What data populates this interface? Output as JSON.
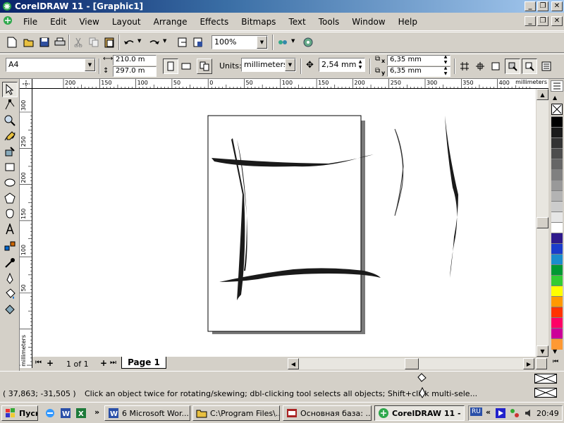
{
  "window": {
    "title": "CorelDRAW 11 - [Graphic1]"
  },
  "menu": [
    "File",
    "Edit",
    "View",
    "Layout",
    "Arrange",
    "Effects",
    "Bitmaps",
    "Text",
    "Tools",
    "Window",
    "Help"
  ],
  "standard_toolbar": {
    "zoom": "100%"
  },
  "property_bar": {
    "paper": "A4",
    "width": "210.0 m",
    "height": "297.0 m",
    "units_label": "Units:",
    "units": "millimeters",
    "nudge": "2,54 mm",
    "dup_x": "6,35 mm",
    "dup_y": "6,35 mm",
    "x_label": "x",
    "y_label": "y"
  },
  "rulers": {
    "units": "millimeters",
    "h_ticks": [
      "200",
      "150",
      "100",
      "50",
      "0",
      "50",
      "100",
      "150",
      "200",
      "250",
      "300",
      "350",
      "400"
    ],
    "v_ticks": [
      "300",
      "250",
      "200",
      "150",
      "100",
      "50"
    ]
  },
  "page_nav": {
    "count": "1 of 1",
    "tab": "Page 1"
  },
  "status": {
    "coords": "( 37,863; -31,505 )",
    "hint": "Click an object twice for rotating/skewing; dbl-clicking tool selects all objects; Shift+click multi-sele..."
  },
  "taskbar": {
    "start": "Пуск",
    "tasks": [
      "6 Microsoft Wor...",
      "C:\\Program Files\\...",
      "Основная база: ...",
      "CorelDRAW 11 - ..."
    ],
    "lang": "RU",
    "clock": "20:49"
  },
  "palette_colors": [
    "#000000",
    "#1a1a1a",
    "#333333",
    "#4d4d4d",
    "#666666",
    "#808080",
    "#999999",
    "#b3b3b3",
    "#cccccc",
    "#e6e6e6",
    "#ffffff",
    "#2e1a8c",
    "#1a3ccc",
    "#1a8ccc",
    "#009933",
    "#33cc33",
    "#ffff00",
    "#ff9900",
    "#ff3300",
    "#ff0066",
    "#cc0099",
    "#ff9933"
  ]
}
